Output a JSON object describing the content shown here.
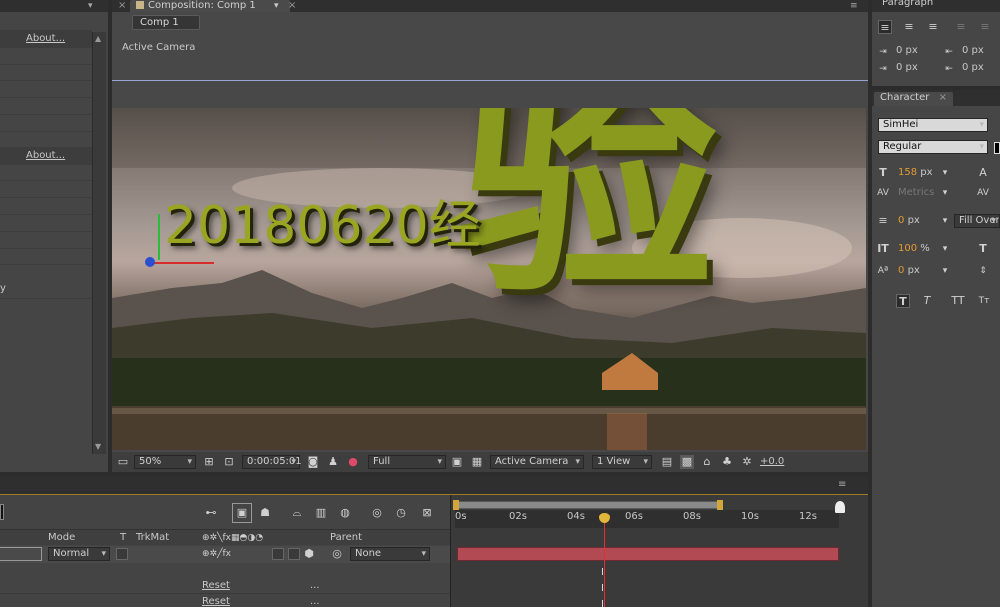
{
  "left_panel": {
    "about_1": "About...",
    "about_2": "About...",
    "partial_label": "y"
  },
  "composition": {
    "tab_label": "Composition: Comp 1",
    "comp_button": "Comp 1",
    "view_label": "Active Camera",
    "viewer_text_date": "20180620经",
    "viewer_text_big": "验",
    "bottom_bar": {
      "zoom": "50%",
      "timecode": "0:00:05:01",
      "resolution": "Full",
      "camera": "Active Camera",
      "views": "1 View",
      "exposure": "+0.0"
    }
  },
  "paragraph": {
    "title": "Paragraph",
    "indent_left": "0 px",
    "indent_right": "0 px",
    "space_before": "0 px",
    "space_after": "0 px"
  },
  "character": {
    "title": "Character",
    "font": "SimHei",
    "style": "Regular",
    "size": "158",
    "size_unit": "px",
    "kerning": "Metrics",
    "stroke": "0",
    "stroke_unit": "px",
    "stroke_mode": "Fill Over",
    "vscale": "100",
    "vscale_unit": "%",
    "baseline": "0",
    "baseline_unit": "px"
  },
  "timeline": {
    "col_mode": "Mode",
    "col_t": "T",
    "col_trkmat": "TrkMat",
    "col_parent": "Parent",
    "layer_mode": "Normal",
    "layer_parent": "None",
    "reset_1": "Reset",
    "reset_2": "Reset",
    "dots_1": "...",
    "dots_2": "...",
    "ruler": [
      "0s",
      "02s",
      "04s",
      "06s",
      "08s",
      "10s",
      "12s"
    ]
  },
  "colors": {
    "accent": "#e39a32",
    "text_green": "#8a9a1e",
    "bar_red": "#b14a52",
    "cti_red": "#e03030"
  }
}
